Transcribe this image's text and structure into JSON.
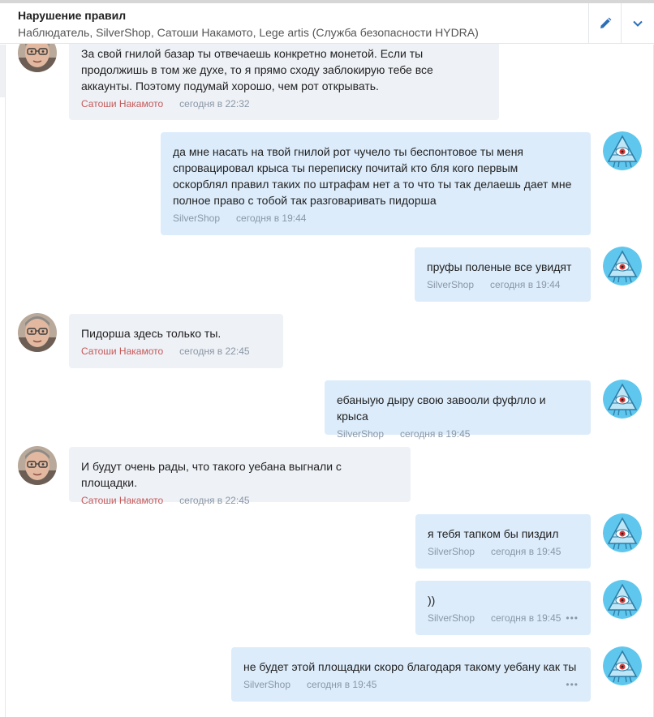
{
  "header": {
    "title": "Нарушение правил",
    "participants": "Наблюдатель, SilverShop, Сатоши Накамото, Lege artis (Служба безопасности HYDRA)",
    "edit_icon": "pencil-icon",
    "more_icon": "chevron-down-icon"
  },
  "colors": {
    "incoming_bubble": "#eef1f6",
    "outgoing_bubble": "#dcecfb",
    "incoming_author": "#c55a5a",
    "outgoing_author": "#8a97a6",
    "accent": "#2a6fb8"
  },
  "messages": [
    {
      "direction": "in",
      "text": "За свой гнилой базар ты отвечаешь конкретно монетой. Если ты\nпродолжишь в том же духе, то я прямо сходу заблокирую тебе все\nаккаунты. Поэтому подумай хорошо, чем рот открывать.",
      "author": "Сатоши Накамото",
      "time": "сегодня в 22:32",
      "dots": ""
    },
    {
      "direction": "out",
      "text": "да мне насать на твой гнилой рот чучело ты беспонтовое ты меня\nспровацировал крыса ты переписку почитай кто бля кого первым\nоскорблял правил таких по штрафам нет а то что ты так делаешь дает мне\nполное право с тобой так разговаривать пидорша",
      "author": "SilverShop",
      "time": "сегодня в 19:44",
      "dots": ""
    },
    {
      "direction": "out",
      "text": "пруфы поленые все увидят",
      "author": "SilverShop",
      "time": "сегодня в 19:44",
      "dots": ""
    },
    {
      "direction": "in",
      "text": "Пидорша здесь только ты.",
      "author": "Сатоши Накамото",
      "time": "сегодня в 22:45",
      "dots": ""
    },
    {
      "direction": "out",
      "text": "ебаныую дыру свою завооли фуфлло и крыса",
      "author": "SilverShop",
      "time": "сегодня в 19:45",
      "dots": ""
    },
    {
      "direction": "in",
      "text": "И будут очень рады, что такого уебана выгнали с площадки.",
      "author": "Сатоши Накамото",
      "time": "сегодня в 22:45",
      "dots": ""
    },
    {
      "direction": "out",
      "text": "я тебя тапком бы пиздил",
      "author": "SilverShop",
      "time": "сегодня в 19:45",
      "dots": ""
    },
    {
      "direction": "out",
      "text": "))",
      "author": "SilverShop",
      "time": "сегодня в 19:45",
      "dots": "•••"
    },
    {
      "direction": "out",
      "text": "не будет этой площадки скоро благодаря такому уебану как ты",
      "author": "SilverShop",
      "time": "сегодня в 19:45",
      "dots": "•••"
    }
  ]
}
